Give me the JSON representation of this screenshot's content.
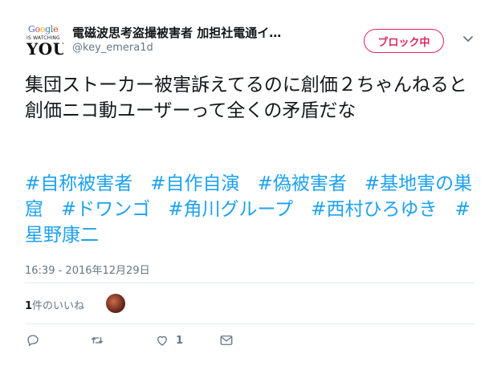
{
  "user": {
    "display_name": "電磁波思考盗撮被害者 加担社電通イ…",
    "handle": "@key_emera1d",
    "avatar": {
      "logo": "Google",
      "tagline": "IS WATCHING",
      "you": "YOU"
    }
  },
  "block_button": {
    "label": "ブロック中"
  },
  "tweet": {
    "text": "集団ストーカー被害訴えてるのに創価２ちゃんねると創価ニコ動ユーザーって全くの矛盾だな",
    "hashtags": [
      "#自称被害者",
      "#自作自演",
      "#偽被害者",
      "#基地害の巣窟",
      "#ドワンゴ",
      "#角川グループ",
      "#西村ひろゆき",
      "#星野康二"
    ],
    "timestamp": "16:39 - 2016年12月29日"
  },
  "likes": {
    "count": "1",
    "label": "件のいいね"
  },
  "actions": {
    "like_count": "1"
  },
  "colors": {
    "accent": "#1da1f2",
    "block": "#e0245e",
    "muted": "#657786"
  },
  "icons": [
    "chevron-down-icon",
    "reply-icon",
    "retweet-icon",
    "heart-icon",
    "envelope-icon"
  ]
}
